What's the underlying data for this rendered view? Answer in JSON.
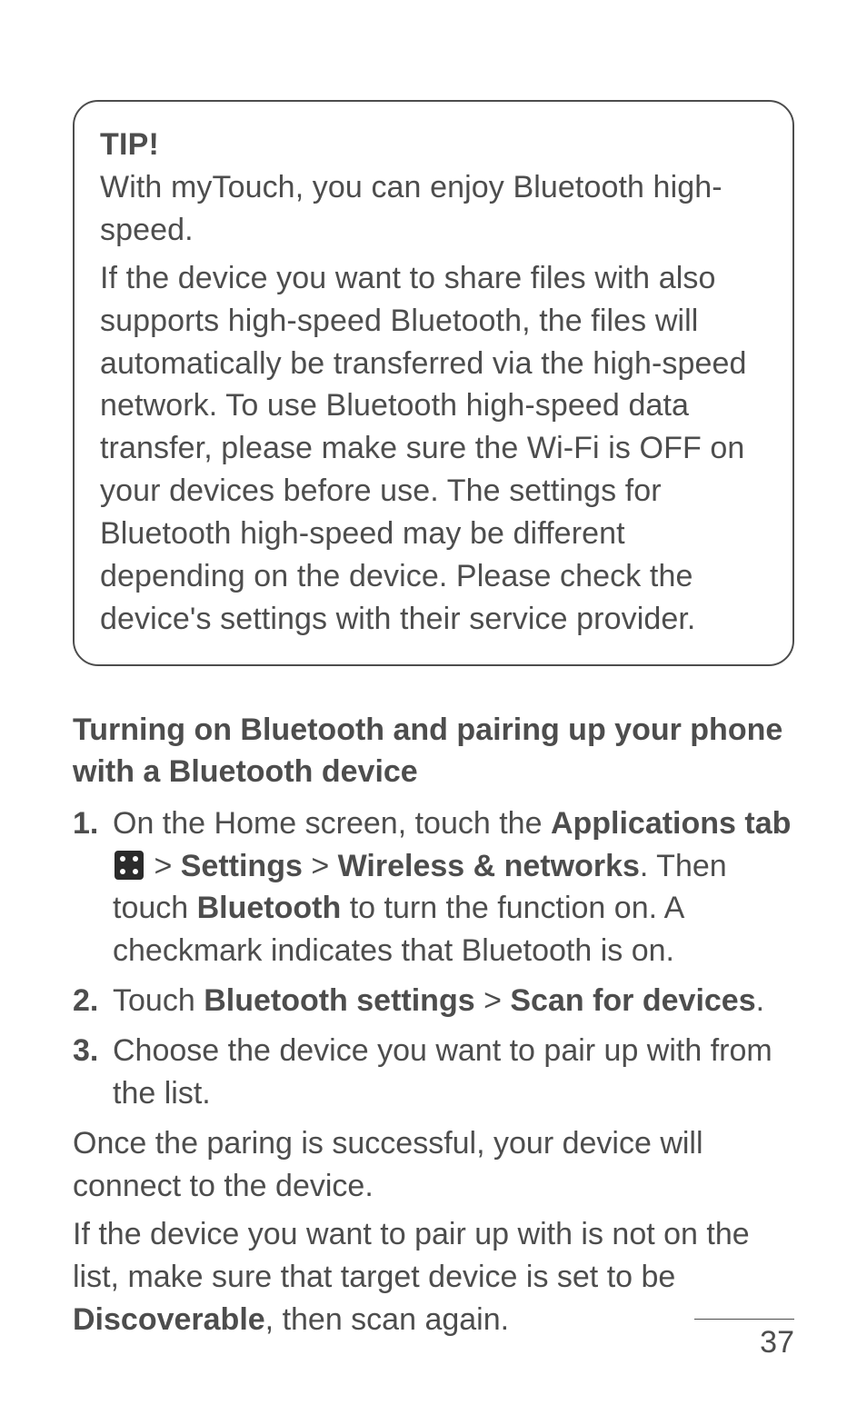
{
  "tip": {
    "title": "TIP!",
    "paragraph1": "With myTouch, you can enjoy Bluetooth high-speed.",
    "paragraph2": "If the device you want to share files with also supports high-speed Bluetooth, the files will automatically be transferred via the high-speed network. To use Bluetooth high-speed data transfer, please make sure the Wi-Fi is OFF on your devices before use. The settings for Bluetooth high-speed may be different depending on the device. Please check the device's settings with their service provider."
  },
  "section": {
    "heading": "Turning on Bluetooth and pairing up your phone with a Bluetooth device"
  },
  "steps": {
    "s1": {
      "pre": "On the Home screen, touch the ",
      "bold1": "Applications tab",
      "gt1": " > ",
      "bold2": "Settings",
      "gt2": " > ",
      "bold3": "Wireless & networks",
      "after3": ". Then touch ",
      "bold4": "Bluetooth",
      "after4": " to turn the function on. A checkmark indicates that Bluetooth is on."
    },
    "s2": {
      "pre": "Touch ",
      "bold1": "Bluetooth settings",
      "gt": " > ",
      "bold2": "Scan for devices",
      "tail": "."
    },
    "s3": {
      "text": "Choose the device you want to pair up with from the list."
    }
  },
  "para1": "Once the paring is successful, your device will connect to the device.",
  "para2": {
    "pre": "If the device you want to pair up with is not on the list, make sure that target device is set to be ",
    "bold": "Discoverable",
    "tail": ", then scan again."
  },
  "pageNumber": "37"
}
